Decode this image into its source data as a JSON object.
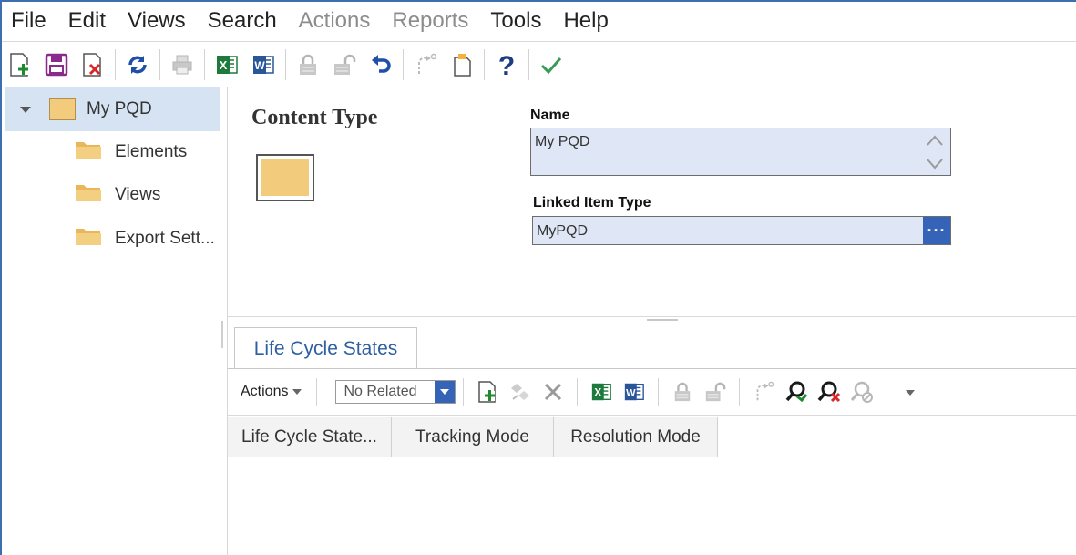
{
  "menu": {
    "items": [
      {
        "label": "File",
        "enabled": true
      },
      {
        "label": "Edit",
        "enabled": true
      },
      {
        "label": "Views",
        "enabled": true
      },
      {
        "label": "Search",
        "enabled": true
      },
      {
        "label": "Actions",
        "enabled": false
      },
      {
        "label": "Reports",
        "enabled": false
      },
      {
        "label": "Tools",
        "enabled": true
      },
      {
        "label": "Help",
        "enabled": true
      }
    ]
  },
  "toolbar": {
    "icons": [
      "new-icon",
      "save-icon",
      "close-icon",
      "refresh-icon",
      "print-icon",
      "excel-icon",
      "word-icon",
      "lock-icon",
      "unlock-icon",
      "undo-icon",
      "revise-icon",
      "copy-icon",
      "help-icon",
      "check-icon"
    ]
  },
  "tree": {
    "root": {
      "label": "My PQD",
      "color": "#f2cb7c"
    },
    "children": [
      {
        "label": "Elements"
      },
      {
        "label": "Views"
      },
      {
        "label": "Export Sett..."
      }
    ]
  },
  "content": {
    "title": "Content Type",
    "swatch_color": "#f2cb7c",
    "name_label": "Name",
    "name_value": "My PQD",
    "linked_label": "Linked Item Type",
    "linked_value": "MyPQD",
    "ellipsis": "···"
  },
  "tabs": [
    {
      "label": "Life Cycle States",
      "active": true
    }
  ],
  "subtoolbar": {
    "actions_label": "Actions",
    "relation_filter": "No Related"
  },
  "grid": {
    "columns": [
      "Life Cycle State...",
      "Tracking Mode",
      "Resolution Mode"
    ]
  },
  "colors": {
    "accent": "#3563b8",
    "selection": "#d6e3f3",
    "field_bg": "#dfe6f5"
  }
}
